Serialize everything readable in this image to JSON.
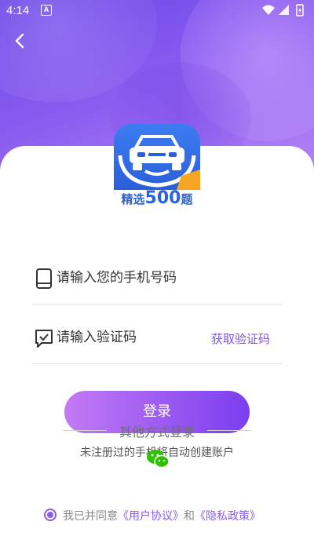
{
  "status_bar": {
    "time": "4:14",
    "notification_letter": "A"
  },
  "logo": {
    "label_prefix": "精选",
    "label_number": "500",
    "label_suffix": "题"
  },
  "phone_field": {
    "placeholder": "请输入您的手机号码",
    "value": ""
  },
  "code_field": {
    "placeholder": "请输入验证码",
    "value": "",
    "get_code_label": "获取验证码"
  },
  "login_button": {
    "label": "登录"
  },
  "other_login": {
    "label": "其他方式登录"
  },
  "auto_create_note": "未注册过的手机将自动创建账户",
  "agreement": {
    "prefix": "我已并同意",
    "user_agreement": "《用户协议》",
    "and": "和",
    "privacy_policy": "《隐私政策》",
    "checked": true
  },
  "colors": {
    "accent": "#8a5cf0",
    "logo_blue": "#2c63d9"
  }
}
